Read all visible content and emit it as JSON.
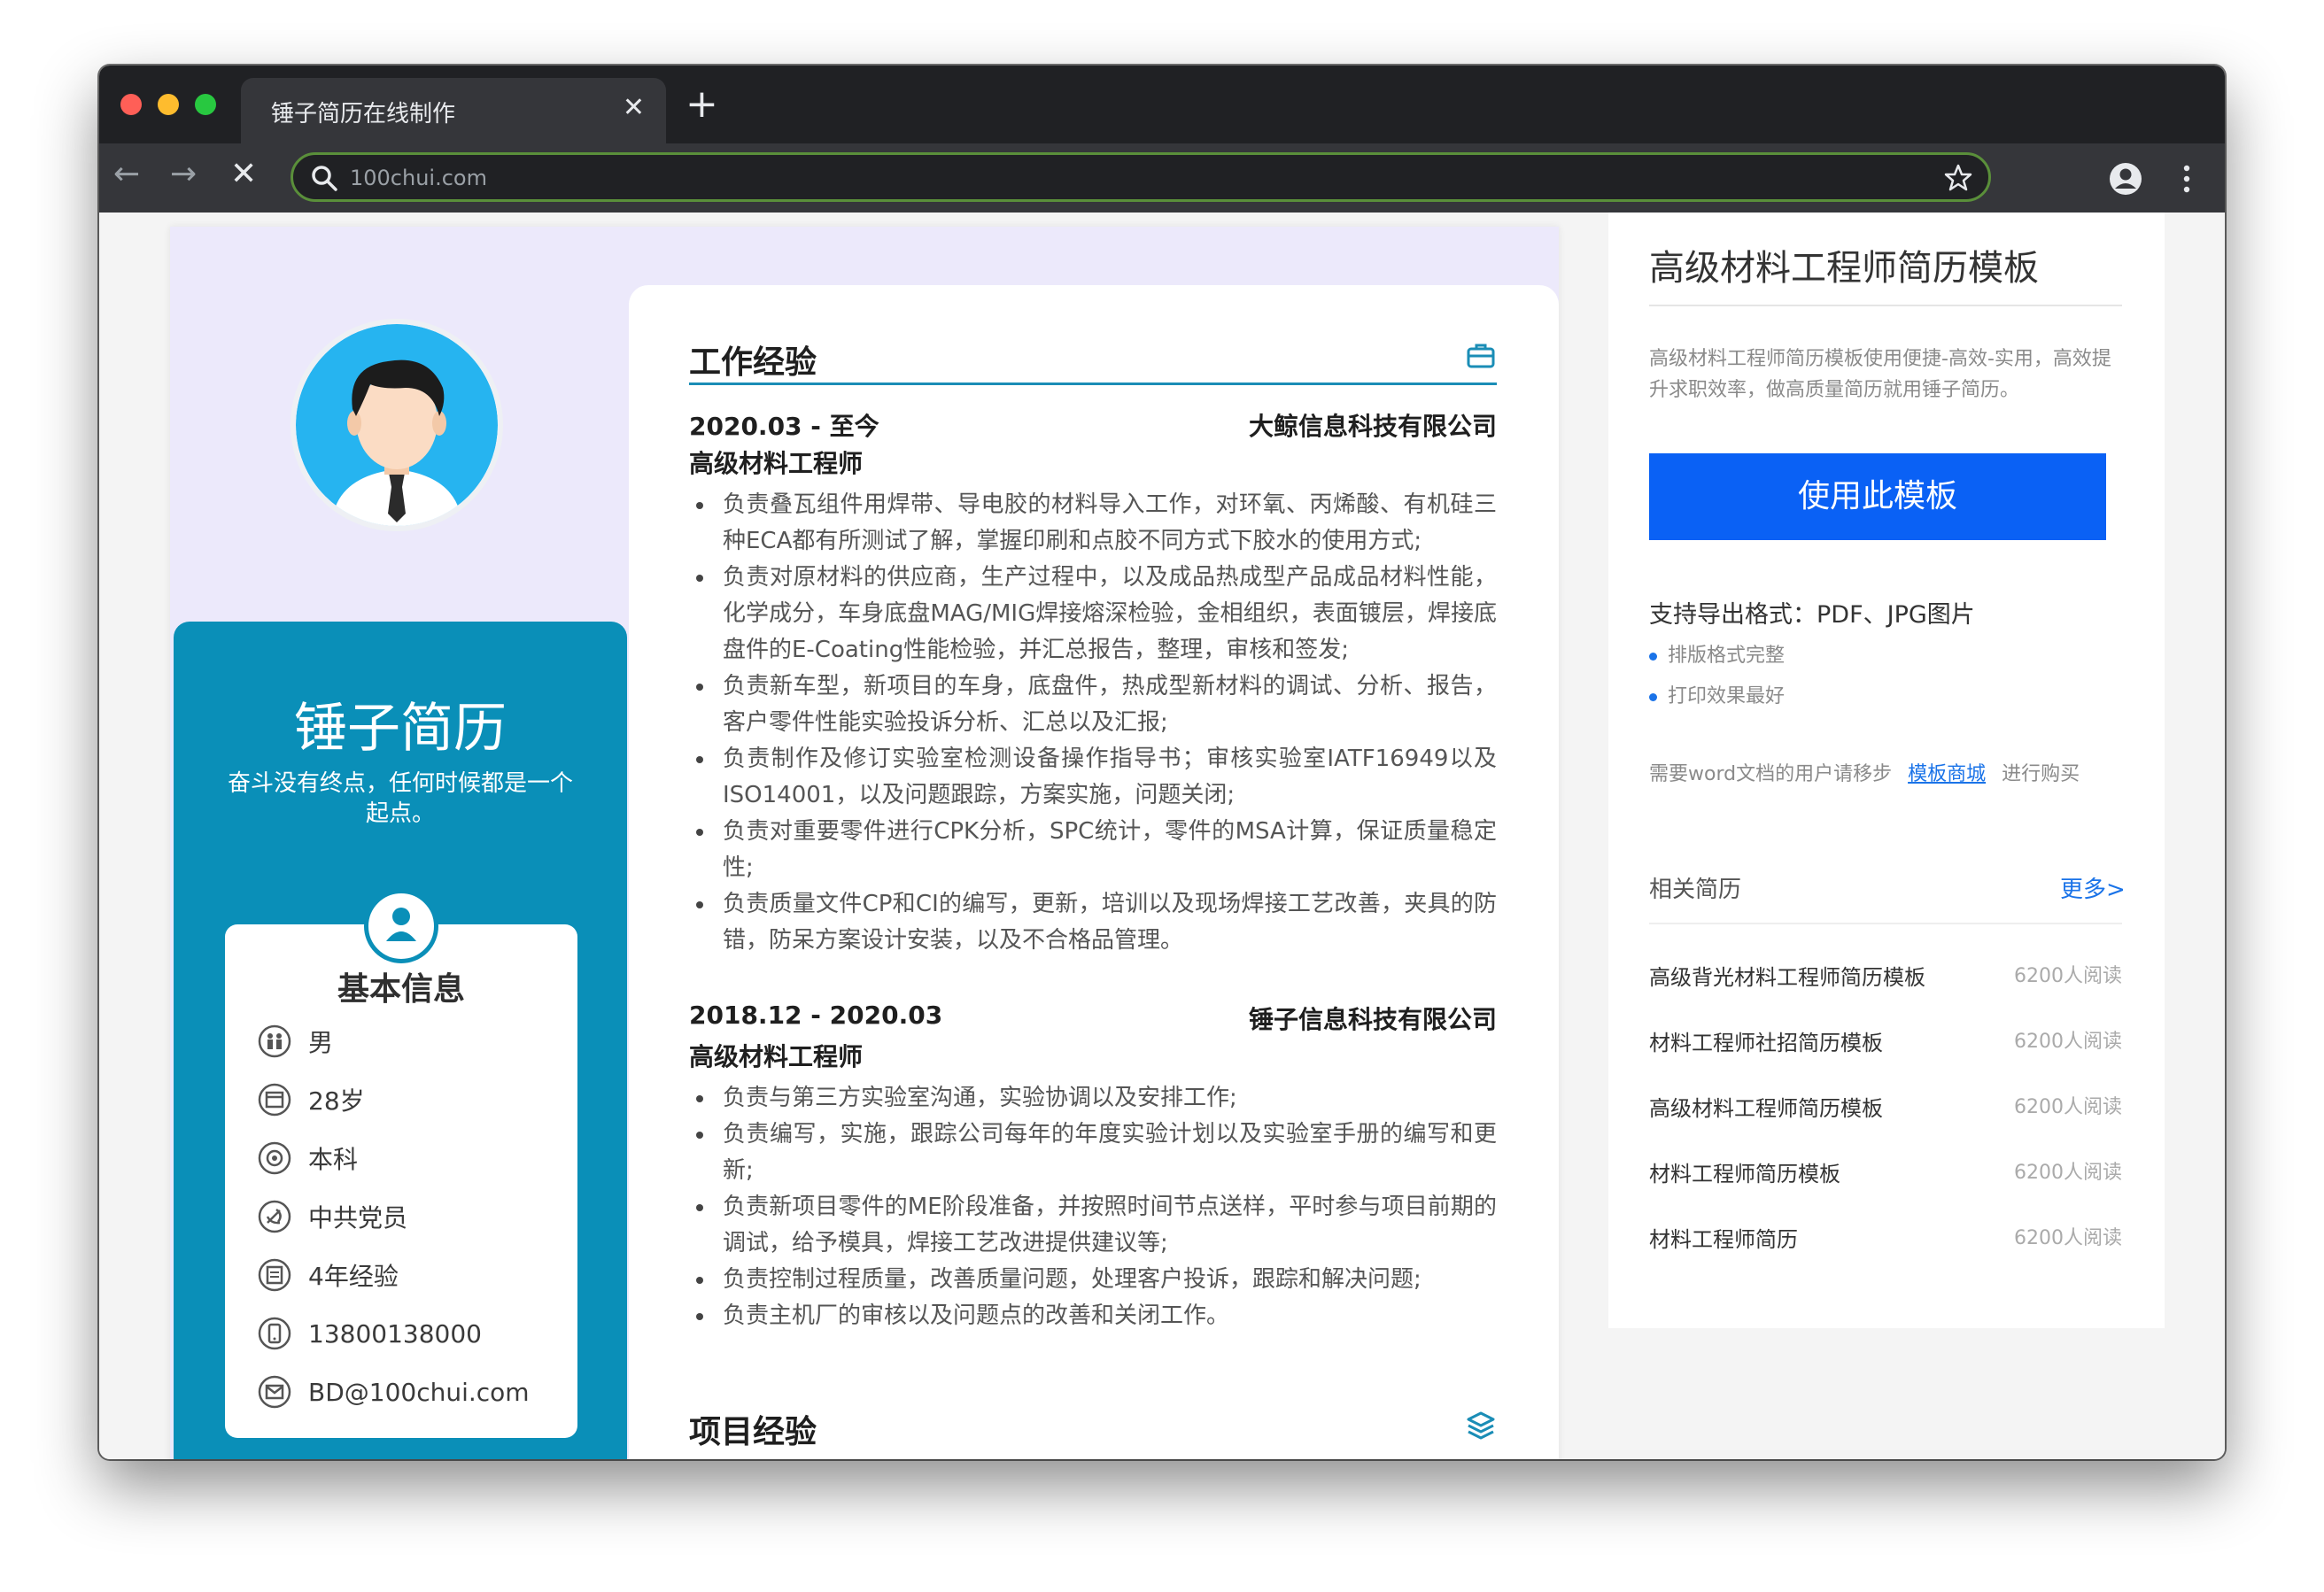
{
  "browser": {
    "tab_title": "锤子简历在线制作",
    "close_glyph": "✕",
    "newtab_glyph": "+",
    "back_glyph": "←",
    "forward_glyph": "→",
    "stop_glyph": "✕",
    "url": "100chui.com",
    "traffic_colors": [
      "#ff5f57",
      "#febc2e",
      "#28c840"
    ]
  },
  "resume": {
    "name": "锤子简历",
    "motto": "奋斗没有终点，任何时候都是一个起点。",
    "accent": "#0a8fb8",
    "basic_info_title": "基本信息",
    "basic_info": [
      {
        "icon": "gender-icon",
        "text": "男"
      },
      {
        "icon": "calendar-icon",
        "text": "28岁"
      },
      {
        "icon": "education-icon",
        "text": "本科"
      },
      {
        "icon": "party-icon",
        "text": "中共党员"
      },
      {
        "icon": "experience-icon",
        "text": "4年经验"
      },
      {
        "icon": "phone-icon",
        "text": "13800138000"
      },
      {
        "icon": "email-icon",
        "text": "BD@100chui.com"
      }
    ],
    "work_title": "工作经验",
    "jobs": [
      {
        "period": "2020.03 - 至今",
        "company": "大鲸信息科技有限公司",
        "role": "高级材料工程师",
        "duties": [
          "负责叠瓦组件用焊带、导电胶的材料导入工作，对环氧、丙烯酸、有机硅三种ECA都有所测试了解，掌握印刷和点胶不同方式下胶水的使用方式;",
          "负责对原材料的供应商，生产过程中，以及成品热成型产品成品材料性能，化学成分，车身底盘MAG/MIG焊接熔深检验，金相组织，表面镀层，焊接底盘件的E-Coating性能检验，并汇总报告，整理，审核和签发;",
          "负责新车型，新项目的车身，底盘件，热成型新材料的调试、分析、报告，客户零件性能实验投诉分析、汇总以及汇报;",
          "负责制作及修订实验室检测设备操作指导书；审核实验室IATF16949以及ISO14001，以及问题跟踪，方案实施，问题关闭;",
          "负责对重要零件进行CPK分析，SPC统计，零件的MSA计算，保证质量稳定性;",
          "负责质量文件CP和CI的编写，更新，培训以及现场焊接工艺改善，夹具的防错，防呆方案设计安装，以及不合格品管理。"
        ]
      },
      {
        "period": "2018.12 - 2020.03",
        "company": "锤子信息科技有限公司",
        "role": "高级材料工程师",
        "duties": [
          "负责与第三方实验室沟通，实验协调以及安排工作;",
          "负责编写，实施，跟踪公司每年的年度实验计划以及实验室手册的编写和更新;",
          "负责新项目零件的ME阶段准备，并按照时间节点送样，平时参与项目前期的调试，给予模具，焊接工艺改进提供建议等;",
          "负责控制过程质量，改善质量问题，处理客户投诉，跟踪和解决问题;",
          "负责主机厂的审核以及问题点的改善和关闭工作。"
        ]
      }
    ],
    "project_title": "项目经验"
  },
  "panel": {
    "title": "高级材料工程师简历模板",
    "desc": "高级材料工程师简历模板使用便捷-高效-实用，高效提升求职效率，做高质量简历就用锤子简历。",
    "use_button": "使用此模板",
    "button_color": "#0a61f5",
    "formats": "支持导出格式：PDF、JPG图片",
    "features": [
      "排版格式完整",
      "打印效果最好"
    ],
    "note_before": "需要word文档的用户请移步",
    "note_link": "模板商城",
    "note_after": "进行购买",
    "related_title": "相关简历",
    "more": "更多>",
    "related": [
      {
        "title": "高级背光材料工程师简历模板",
        "reads": "6200人阅读"
      },
      {
        "title": "材料工程师社招简历模板",
        "reads": "6200人阅读"
      },
      {
        "title": "高级材料工程师简历模板",
        "reads": "6200人阅读"
      },
      {
        "title": "材料工程师简历模板",
        "reads": "6200人阅读"
      },
      {
        "title": "材料工程师简历",
        "reads": "6200人阅读"
      }
    ]
  }
}
